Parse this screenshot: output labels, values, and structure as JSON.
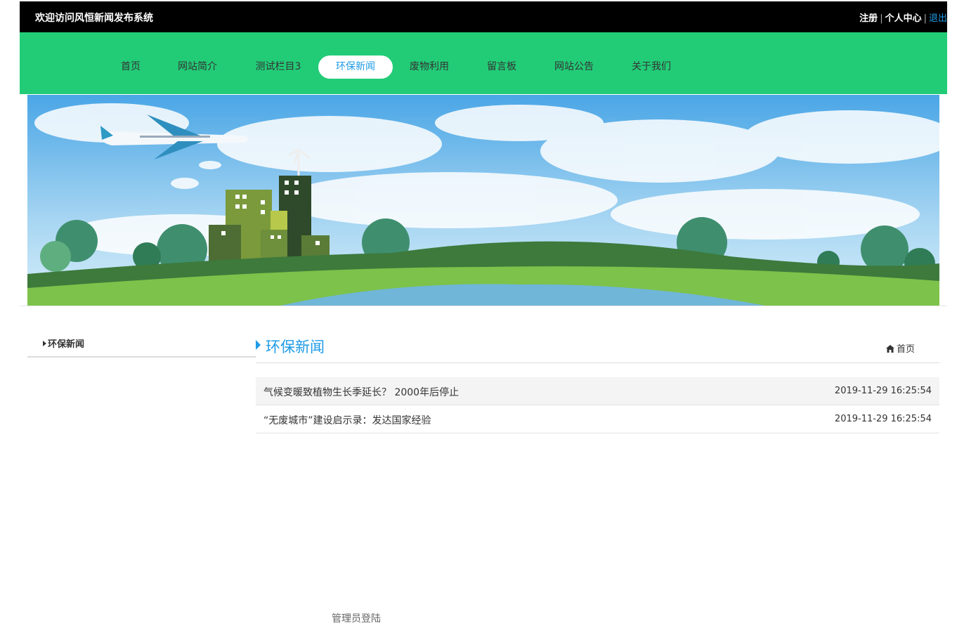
{
  "header": {
    "welcome": "欢迎访问风恒新闻发布系统",
    "register": "注册",
    "profile": "个人中心",
    "logout": "退出",
    "separator": "|"
  },
  "nav": {
    "items": [
      {
        "label": "首页"
      },
      {
        "label": "网站简介"
      },
      {
        "label": "测试栏目3"
      },
      {
        "label": "环保新闻",
        "active": true
      },
      {
        "label": "废物利用"
      },
      {
        "label": "留言板"
      },
      {
        "label": "网站公告"
      },
      {
        "label": "关于我们"
      }
    ]
  },
  "sidebar": {
    "title": "环保新闻"
  },
  "section": {
    "title": "环保新闻",
    "breadcrumb_home": "首页"
  },
  "news": [
    {
      "title": "气候变暖致植物生长季延长？ 2000年后停止",
      "date": "2019-11-29 16:25:54"
    },
    {
      "title": "“无废城市”建设启示录：发达国家经验",
      "date": "2019-11-29 16:25:54"
    }
  ],
  "footer": {
    "admin_login": "管理员登陆"
  },
  "colors": {
    "nav_bg": "#22cc77",
    "accent": "#1e9be6",
    "topbar_bg": "#000000"
  },
  "icons": {
    "breadcrumb": "home-icon"
  }
}
